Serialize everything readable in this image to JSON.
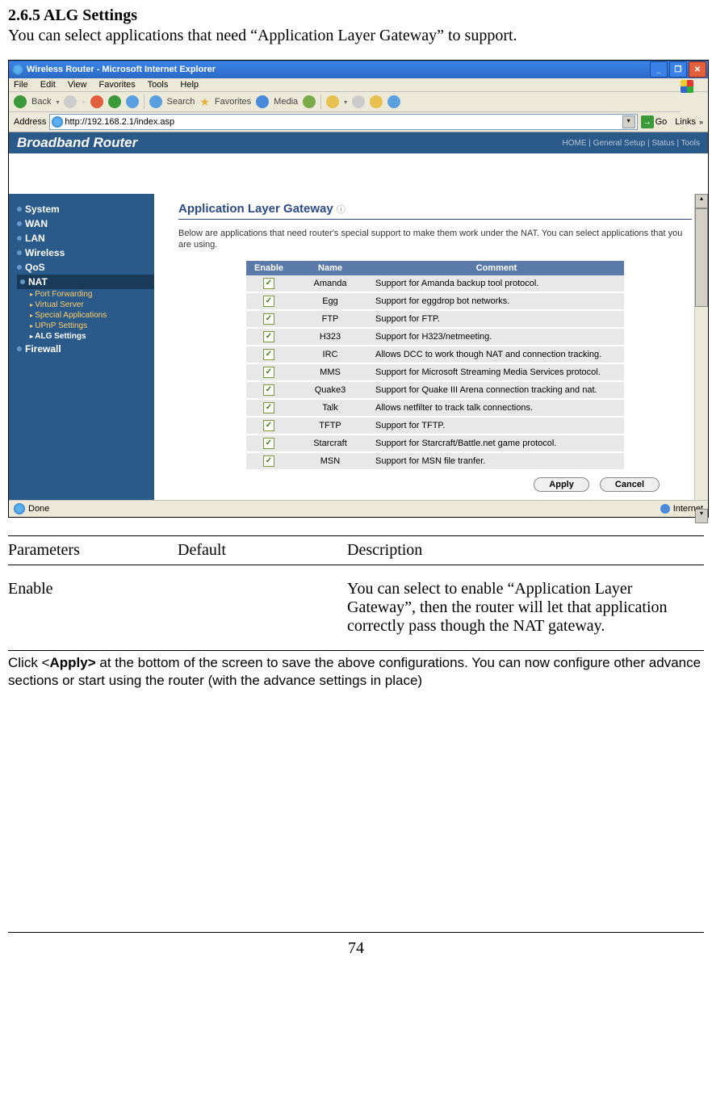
{
  "doc": {
    "section_number": "2.6.5 ALG Settings",
    "intro": "You can select applications that need “Application Layer Gateway” to support.",
    "page_number": "74"
  },
  "browser": {
    "title": "Wireless Router - Microsoft Internet Explorer",
    "menu": {
      "file": "File",
      "edit": "Edit",
      "view": "View",
      "favorites": "Favorites",
      "tools": "Tools",
      "help": "Help"
    },
    "toolbar": {
      "back": "Back",
      "search": "Search",
      "favorites": "Favorites",
      "media": "Media"
    },
    "address_label": "Address",
    "address_value": "http://192.168.2.1/index.asp",
    "go": "Go",
    "links": "Links",
    "status_left": "Done",
    "status_right": "Internet"
  },
  "router": {
    "brand": "Broadband Router",
    "topnav": "HOME | General Setup | Status | Tools",
    "sidebar": {
      "items": [
        {
          "label": "System"
        },
        {
          "label": "WAN"
        },
        {
          "label": "LAN"
        },
        {
          "label": "Wireless"
        },
        {
          "label": "QoS"
        },
        {
          "label": "NAT"
        },
        {
          "label": "Firewall"
        }
      ],
      "nat_sub": [
        {
          "label": "Port Forwarding"
        },
        {
          "label": "Virtual Server"
        },
        {
          "label": "Special Applications"
        },
        {
          "label": "UPnP Settings"
        },
        {
          "label": "ALG Settings"
        }
      ]
    },
    "page_title": "Application Layer Gateway",
    "page_desc": "Below are applications that need router's special support to make them work under the NAT. You can select applications that you are using.",
    "table_headers": {
      "enable": "Enable",
      "name": "Name",
      "comment": "Comment"
    },
    "rows": [
      {
        "name": "Amanda",
        "comment": "Support for Amanda backup tool protocol."
      },
      {
        "name": "Egg",
        "comment": "Support for eggdrop bot networks."
      },
      {
        "name": "FTP",
        "comment": "Support for FTP."
      },
      {
        "name": "H323",
        "comment": "Support for H323/netmeeting."
      },
      {
        "name": "IRC",
        "comment": "Allows DCC to work though NAT and connection tracking."
      },
      {
        "name": "MMS",
        "comment": "Support for Microsoft Streaming Media Services protocol."
      },
      {
        "name": "Quake3",
        "comment": "Support for Quake III Arena connection tracking and nat."
      },
      {
        "name": "Talk",
        "comment": "Allows netfilter to track talk connections."
      },
      {
        "name": "TFTP",
        "comment": "Support for TFTP."
      },
      {
        "name": "Starcraft",
        "comment": "Support for Starcraft/Battle.net game protocol."
      },
      {
        "name": "MSN",
        "comment": "Support for MSN file tranfer."
      }
    ],
    "buttons": {
      "apply": "Apply",
      "cancel": "Cancel"
    }
  },
  "param_table": {
    "h1": "Parameters",
    "h2": "Default",
    "h3": "Description",
    "row1_param": "Enable",
    "row1_default": "",
    "row1_desc": "You can select to enable “Application Layer Gateway”, then the router will let that application correctly pass though the NAT gateway."
  },
  "apply_note_1": "Click <",
  "apply_note_bold": "Apply>",
  "apply_note_2": " at the bottom of the screen to save the above configurations. You can now configure other advance sections or start using the router (with the advance settings in place)"
}
